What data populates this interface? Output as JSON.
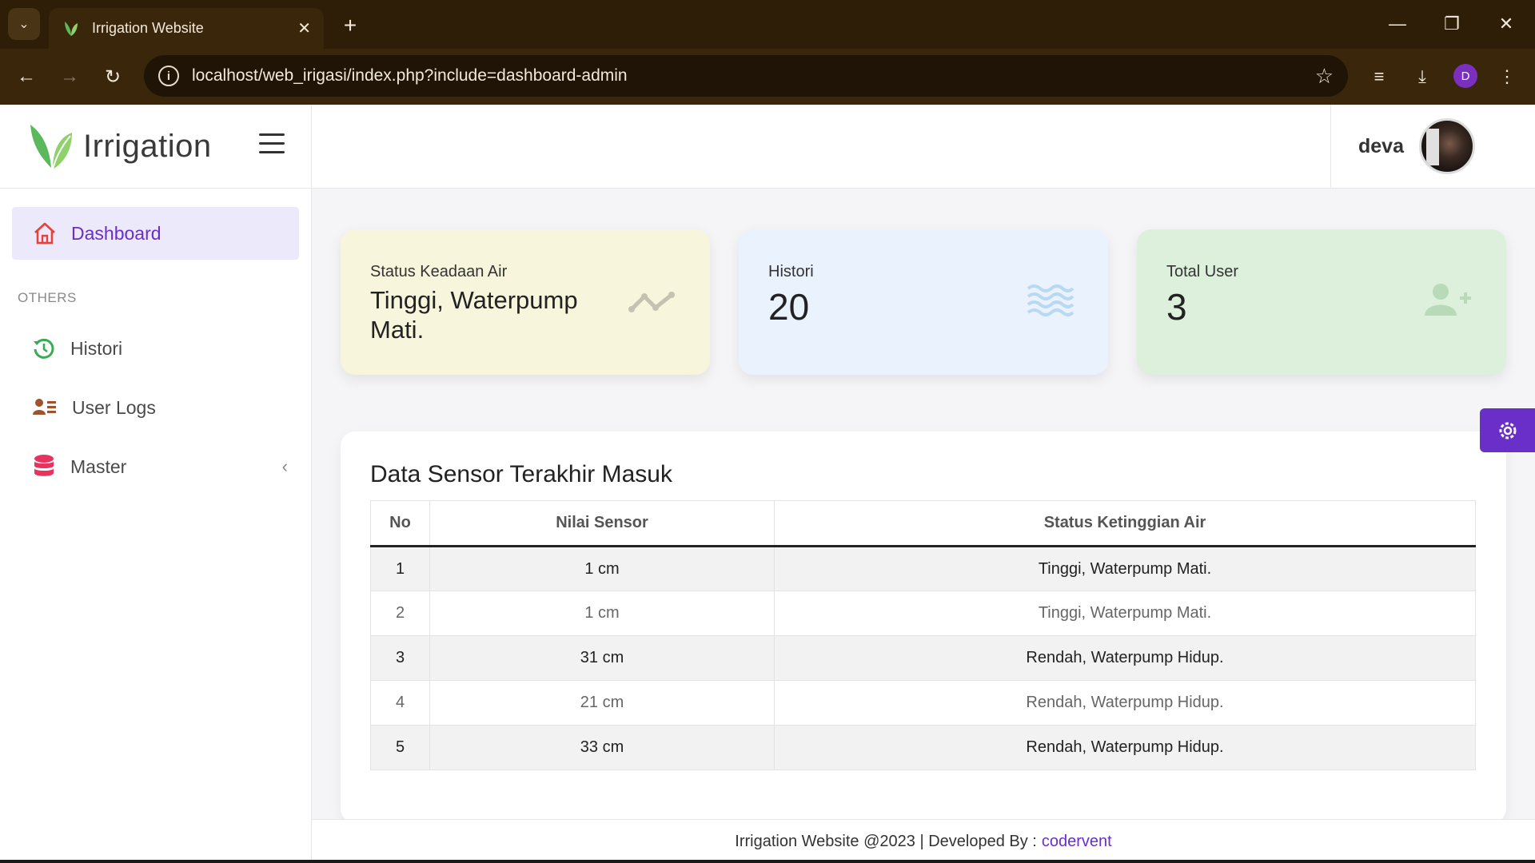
{
  "browser": {
    "tab_title": "Irrigation Website",
    "url": "localhost/web_irigasi/index.php?include=dashboard-admin",
    "profile_initial": "D"
  },
  "sidebar": {
    "brand": "Irrigation",
    "active_item": "Dashboard",
    "section_header": "OTHERS",
    "items": [
      {
        "label": "Histori",
        "icon": "history-icon"
      },
      {
        "label": "User Logs",
        "icon": "user-list-icon"
      },
      {
        "label": "Master",
        "icon": "database-icon"
      }
    ]
  },
  "topbar": {
    "username": "deva"
  },
  "cards": {
    "status": {
      "label": "Status Keadaan Air",
      "value": "Tinggi, Waterpump Mati.",
      "color": "#f7f5dc"
    },
    "histori": {
      "label": "Histori",
      "value": "20",
      "color": "#eaf3fd"
    },
    "users": {
      "label": "Total User",
      "value": "3",
      "color": "#dcf0dc"
    }
  },
  "panel": {
    "title": "Data Sensor Terakhir Masuk",
    "columns": [
      "No",
      "Nilai Sensor",
      "Status Ketinggian Air"
    ],
    "rows": [
      [
        "1",
        "1 cm",
        "Tinggi, Waterpump Mati."
      ],
      [
        "2",
        "1 cm",
        "Tinggi, Waterpump Mati."
      ],
      [
        "3",
        "31 cm",
        "Rendah, Waterpump Hidup."
      ],
      [
        "4",
        "21 cm",
        "Rendah, Waterpump Hidup."
      ],
      [
        "5",
        "33 cm",
        "Rendah, Waterpump Hidup."
      ]
    ]
  },
  "footer": {
    "text": "Irrigation Website @2023 | Developed By :",
    "link": "codervent"
  },
  "colors": {
    "accent": "#6a2fc8",
    "chrome": "#3a260a"
  }
}
